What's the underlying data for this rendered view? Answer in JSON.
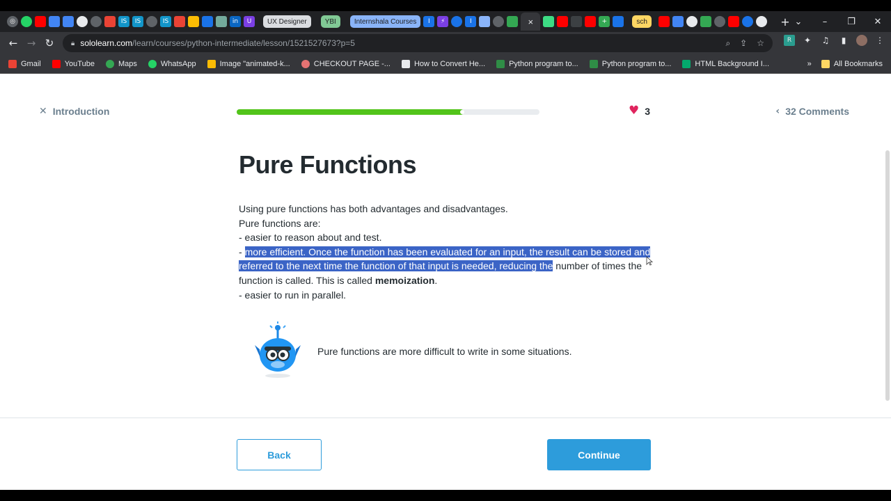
{
  "browser": {
    "tab_groups": [
      "UX Designer",
      "YBI",
      "Internshala Courses",
      "sch"
    ],
    "active_tab_close": "×",
    "new_tab": "+",
    "url_domain": "sololearn.com",
    "url_path": "/learn/courses/python-intermediate/lesson/1521527673?p=5",
    "bookmarks": [
      "Gmail",
      "YouTube",
      "Maps",
      "WhatsApp",
      "Image \"animated-k...",
      "CHECKOUT PAGE -...",
      "How to Convert He...",
      "Python program to...",
      "Python program to...",
      "HTML Background I..."
    ],
    "all_bookmarks": "All Bookmarks",
    "bookmark_more": "»"
  },
  "header": {
    "close_label": "Introduction",
    "progress_percent": 75,
    "hearts": "3",
    "comments": "32 Comments"
  },
  "lesson": {
    "title": "Pure Functions",
    "line1": "Using pure functions has both advantages and disadvantages.",
    "line2": "Pure functions are:",
    "line3": "- easier to reason about and test.",
    "line4_prefix": "- ",
    "line4_highlight": "more efficient. Once the function has been evaluated for an input, the result can be stored and referred to the next time the function of that input is needed, reducing the",
    "line4_rest": " number of times the function is called. This is called ",
    "line4_bold": "memoization",
    "line4_end": ".",
    "line5": "- easier to run in parallel.",
    "tip": "Pure functions are more difficult to write in some situations."
  },
  "footer": {
    "back": "Back",
    "continue": "Continue"
  },
  "colors": {
    "accent": "#2d9cdb",
    "progress": "#52c41a",
    "heart": "#e0245e",
    "highlight": "#3b64c6"
  }
}
